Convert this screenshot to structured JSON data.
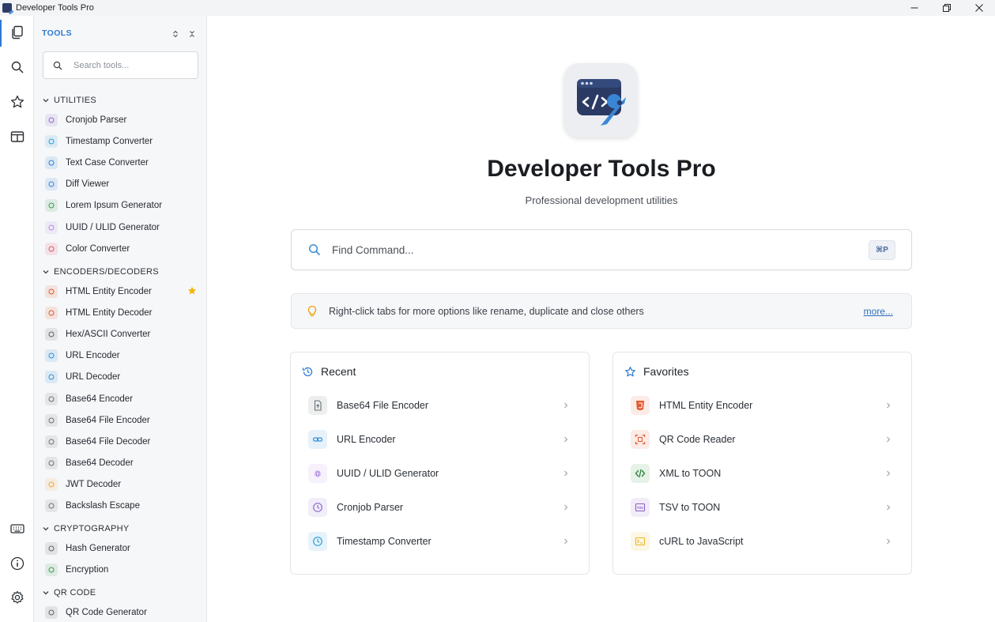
{
  "window": {
    "title": "Developer Tools Pro"
  },
  "activity_bar": {
    "top": [
      "tools-icon",
      "search-icon",
      "star-icon",
      "panel-icon"
    ],
    "bottom": [
      "keyboard-icon",
      "info-icon",
      "settings-icon"
    ]
  },
  "sidebar": {
    "title": "TOOLS",
    "search_placeholder": "Search tools...",
    "categories": [
      {
        "label": "UTILITIES",
        "items": [
          {
            "label": "Cronjob Parser",
            "color": "#8c6bd1"
          },
          {
            "label": "Timestamp Converter",
            "color": "#2f9bd6"
          },
          {
            "label": "Text Case Converter",
            "color": "#2f7fd1"
          },
          {
            "label": "Diff Viewer",
            "color": "#3b7fd6"
          },
          {
            "label": "Lorem Ipsum Generator",
            "color": "#3d9a4f"
          },
          {
            "label": "UUID / ULID Generator",
            "color": "#b18be0"
          },
          {
            "label": "Color Converter",
            "color": "#e0566d"
          }
        ]
      },
      {
        "label": "ENCODERS/DECODERS",
        "items": [
          {
            "label": "HTML Entity Encoder",
            "color": "#e4572e",
            "favorite": true
          },
          {
            "label": "HTML Entity Decoder",
            "color": "#e4572e"
          },
          {
            "label": "Hex/ASCII Converter",
            "color": "#5c6168"
          },
          {
            "label": "URL Encoder",
            "color": "#2f8fd6"
          },
          {
            "label": "URL Decoder",
            "color": "#2f8fd6"
          },
          {
            "label": "Base64 Encoder",
            "color": "#6b7077"
          },
          {
            "label": "Base64 File Encoder",
            "color": "#6b7077"
          },
          {
            "label": "Base64 File Decoder",
            "color": "#6b7077"
          },
          {
            "label": "Base64 Decoder",
            "color": "#6b7077"
          },
          {
            "label": "JWT Decoder",
            "color": "#f0a640"
          },
          {
            "label": "Backslash Escape",
            "color": "#6b7077"
          }
        ]
      },
      {
        "label": "CRYPTOGRAPHY",
        "items": [
          {
            "label": "Hash Generator",
            "color": "#5c6168"
          },
          {
            "label": "Encryption",
            "color": "#3d9a4f"
          }
        ]
      },
      {
        "label": "QR CODE",
        "items": [
          {
            "label": "QR Code Generator",
            "color": "#5c6168"
          }
        ]
      }
    ]
  },
  "main": {
    "app_name": "Developer Tools Pro",
    "subtitle": "Professional development utilities",
    "command_placeholder": "Find Command...",
    "command_shortcut": "⌘P",
    "tip_text": "Right-click tabs for more options like rename, duplicate and close others",
    "tip_more": "more...",
    "recent": {
      "title": "Recent",
      "items": [
        {
          "label": "Base64 File Encoder",
          "icon": "file-upload-icon",
          "color": "#6b7077"
        },
        {
          "label": "URL Encoder",
          "icon": "link-icon",
          "color": "#2f8fd6"
        },
        {
          "label": "UUID / ULID Generator",
          "icon": "fingerprint-icon",
          "color": "#b18be0"
        },
        {
          "label": "Cronjob Parser",
          "icon": "clock-icon",
          "color": "#8c6bd1"
        },
        {
          "label": "Timestamp Converter",
          "icon": "clock-icon",
          "color": "#2f9bd6"
        }
      ]
    },
    "favorites": {
      "title": "Favorites",
      "items": [
        {
          "label": "HTML Entity Encoder",
          "icon": "html5-icon",
          "color": "#e4572e"
        },
        {
          "label": "QR Code Reader",
          "icon": "qr-scan-icon",
          "color": "#e4572e"
        },
        {
          "label": "XML to TOON",
          "icon": "code-icon",
          "color": "#2e8b3e"
        },
        {
          "label": "TSV to TOON",
          "icon": "tsv-icon",
          "color": "#8c5fc7"
        },
        {
          "label": "cURL to JavaScript",
          "icon": "terminal-icon",
          "color": "#e8b923"
        }
      ]
    }
  },
  "colors": {
    "accent": "#2e7ad1",
    "favorite_star": "#f5b400"
  }
}
